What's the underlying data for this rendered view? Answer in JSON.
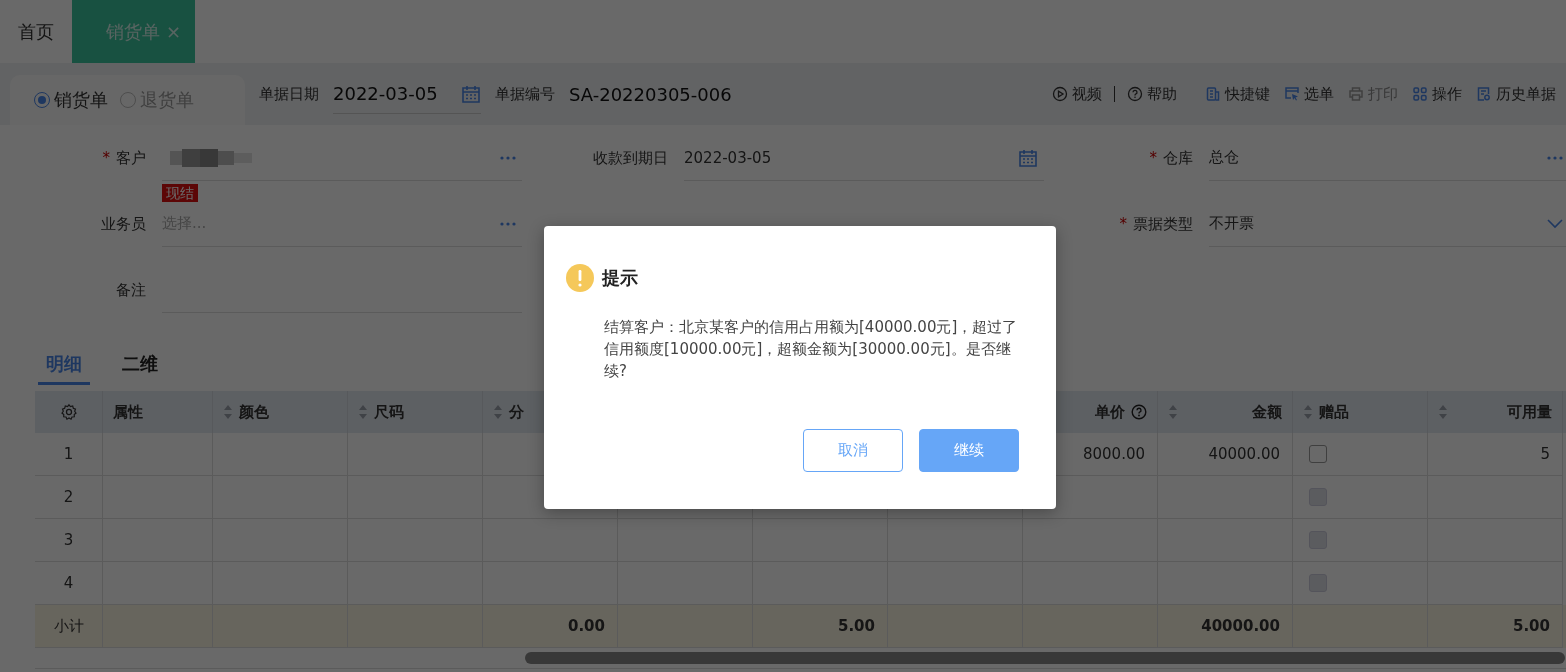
{
  "tabs": [
    {
      "label": "首页",
      "selected": false
    },
    {
      "label": "销货单",
      "selected": true,
      "close": "×"
    }
  ],
  "doc_types": [
    {
      "label": "销货单",
      "selected": true
    },
    {
      "label": "退货单",
      "selected": false
    }
  ],
  "header_fields": [
    {
      "label": "单据日期",
      "value": "2022-03-05",
      "kind": "date"
    },
    {
      "label": "单据编号",
      "value": "SA-20220305-006",
      "kind": "text"
    }
  ],
  "help_links": [
    {
      "label": "视频"
    },
    {
      "label": "帮助"
    }
  ],
  "toolbar": [
    {
      "label": "快捷键",
      "disabled": false
    },
    {
      "label": "选单",
      "disabled": false
    },
    {
      "label": "打印",
      "disabled": true
    },
    {
      "label": "操作",
      "disabled": false
    },
    {
      "label": "历史单据",
      "disabled": false
    }
  ],
  "form": {
    "rows": [
      [
        {
          "kind": "lookup",
          "label": "客户",
          "required_mark": "*",
          "redacted": true,
          "tag": "现结"
        },
        {
          "kind": "date",
          "label": "收款到期日",
          "value": "2022-03-05"
        },
        {
          "kind": "lookup",
          "label": "仓库",
          "required_mark": "*",
          "value": "总仓"
        }
      ],
      [
        {
          "kind": "lookup",
          "label": "业务员",
          "placeholder": "选择..."
        },
        {
          "kind": "empty"
        },
        {
          "kind": "select",
          "label": "票据类型",
          "required_mark": "*",
          "value": "不开票"
        }
      ],
      [
        {
          "kind": "text",
          "label": "备注"
        },
        {
          "kind": "empty"
        },
        {
          "kind": "empty"
        }
      ]
    ]
  },
  "detail_tabs": [
    {
      "label": "明细",
      "selected": true
    },
    {
      "label": "二维",
      "selected": false
    }
  ],
  "table": {
    "columns": [
      {
        "label": "属性",
        "kind": "text",
        "sortable": false
      },
      {
        "label": "颜色",
        "kind": "text",
        "sortable": true
      },
      {
        "label": "尺码",
        "kind": "text",
        "sortable": true
      },
      {
        "label": "分",
        "kind": "number",
        "sortable": true
      },
      {
        "kind": "number"
      },
      {
        "kind": "number"
      },
      {
        "kind": "number"
      },
      {
        "label": "单价",
        "kind": "amount",
        "sortable": false,
        "help": true
      },
      {
        "label": "金额",
        "kind": "amount",
        "sortable": true
      },
      {
        "label": "赠品",
        "kind": "checkbox",
        "sortable": true
      },
      {
        "label": "可用量",
        "kind": "amount",
        "sortable": true
      }
    ],
    "rows": [
      {
        "no": "1",
        "cells": [
          null,
          null,
          null,
          null,
          null,
          null,
          null,
          "8000.00",
          "40000.00",
          {
            "checked": false,
            "disabled": false
          },
          "5"
        ]
      },
      {
        "no": "2",
        "cells": [
          null,
          null,
          null,
          null,
          null,
          null,
          null,
          null,
          null,
          {
            "checked": false,
            "disabled": true
          },
          null
        ]
      },
      {
        "no": "3",
        "cells": [
          null,
          null,
          null,
          null,
          null,
          null,
          null,
          null,
          null,
          {
            "checked": false,
            "disabled": true
          },
          null
        ]
      },
      {
        "no": "4",
        "cells": [
          null,
          null,
          null,
          null,
          null,
          null,
          null,
          null,
          null,
          {
            "checked": false,
            "disabled": true
          },
          null
        ]
      }
    ],
    "subtotal": {
      "label": "小计",
      "cells": [
        null,
        null,
        null,
        "0.00",
        null,
        "5.00",
        null,
        null,
        "40000.00",
        null,
        "5.00"
      ]
    }
  },
  "dialog": {
    "title": "提示",
    "message": "结算客户：北京某客户的信用占用额为[40000.00元]，超过了信用额度[10000.00元]，超额金额为[30000.00元]。是否继续?",
    "buttons": [
      {
        "label": "取消",
        "kind": "secondary"
      },
      {
        "label": "继续",
        "kind": "primary"
      }
    ]
  }
}
